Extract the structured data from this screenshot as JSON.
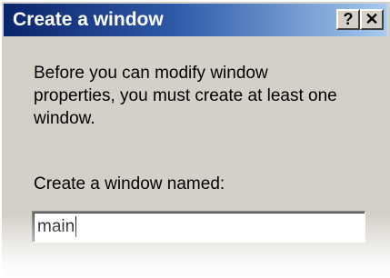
{
  "dialog": {
    "title": "Create a window",
    "help_button": "?",
    "close_button": "✕",
    "message": "Before you can modify window properties, you must create at least one window.",
    "field_label": "Create a window named:",
    "field_value": "main"
  },
  "colors": {
    "title_start": "#0a246a",
    "title_end": "#a6caf0",
    "face": "#d4d0c8"
  }
}
